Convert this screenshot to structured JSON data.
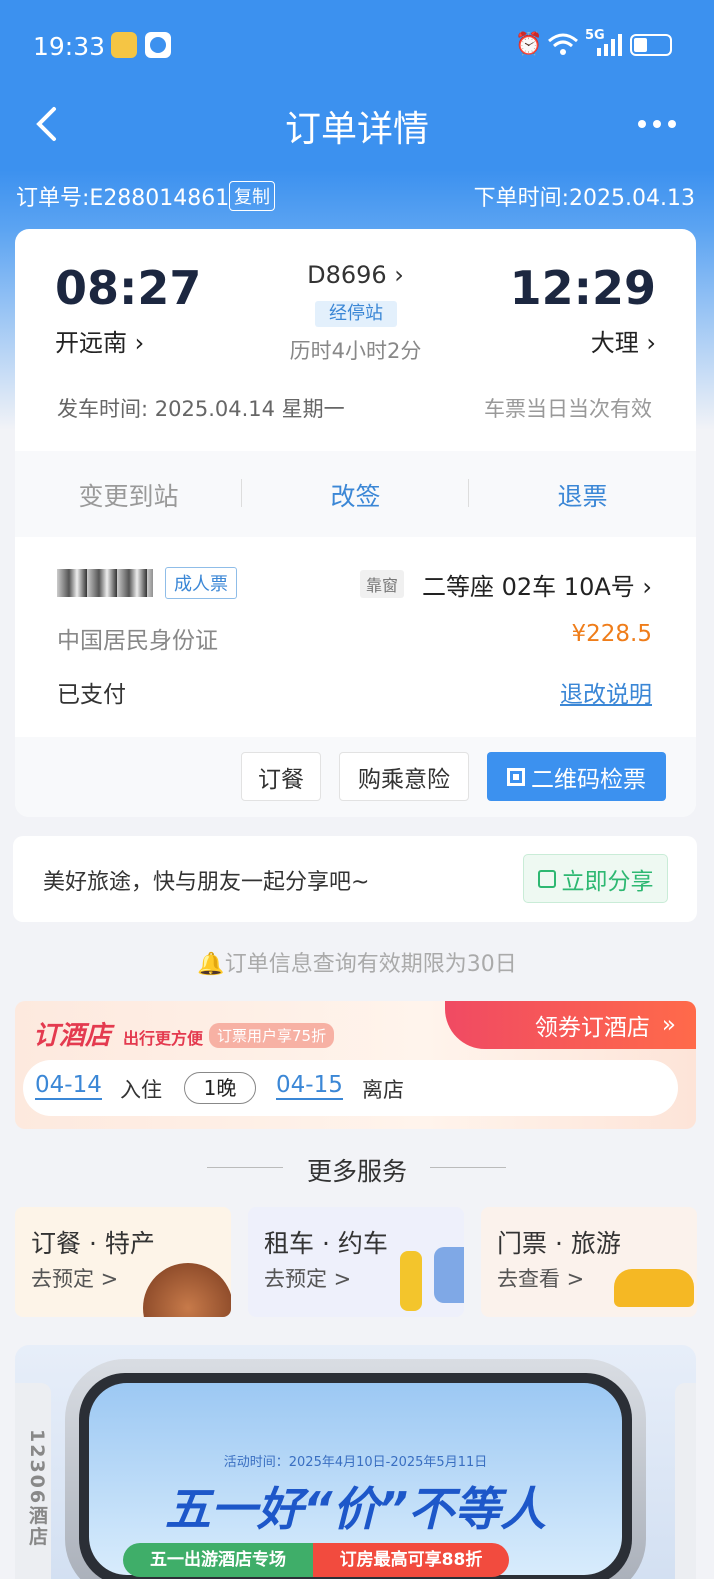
{
  "status_bar": {
    "time": "19:33",
    "network": "5G"
  },
  "nav": {
    "title": "订单详情"
  },
  "order": {
    "number_label": "订单号:E288014861",
    "copy_label": "复制",
    "time_label": "下单时间:2025.04.13"
  },
  "trip": {
    "dep_time": "08:27",
    "dep_station": "开远南",
    "train_no": "D8696",
    "stops_label": "经停站",
    "duration": "历时4小时2分",
    "arr_time": "12:29",
    "arr_station": "大理",
    "departure_label": "发车时间: 2025.04.14 星期一",
    "validity": "车票当日当次有效"
  },
  "actions": {
    "change_station": "变更到站",
    "rebook": "改签",
    "refund": "退票"
  },
  "passenger": {
    "ticket_type": "成人票",
    "window_tag": "靠窗",
    "seat": "二等座 02车 10A号",
    "id_type": "中国居民身份证",
    "price": "¥228.5",
    "pay_status": "已支付",
    "rules_link": "退改说明"
  },
  "ticket_buttons": {
    "meal": "订餐",
    "insurance": "购乘意险",
    "qr": "二维码检票"
  },
  "share": {
    "text": "美好旅途，快与朋友一起分享吧~",
    "button": "立即分享"
  },
  "notice": "订单信息查询有效期限为30日",
  "hotel": {
    "title": "订酒店",
    "slogan": "出行更方便",
    "promo": "订票用户享75折",
    "coupon": "领券订酒店",
    "checkin_date": "04-14",
    "checkin_label": "入住",
    "nights": "1晚",
    "checkout_date": "04-15",
    "checkout_label": "离店"
  },
  "more": {
    "title": "更多服务",
    "items": [
      {
        "title": "订餐 · 特产",
        "sub": "去预定 >"
      },
      {
        "title": "租车 · 约车",
        "sub": "去预定 >"
      },
      {
        "title": "门票 · 旅游",
        "sub": "去查看 >"
      }
    ]
  },
  "banner": {
    "side_text": "12306酒店",
    "period": "活动时间：2025年4月10日-2025年5月11日",
    "headline": "五一好“价”不等人",
    "pill_left": "五一出游酒店专场",
    "pill_right": "订房最高可享88折"
  },
  "colors": {
    "primary": "#3c91ef",
    "accent_blue": "#3b87d6",
    "price": "#ef7d1a",
    "share_green": "#2eb872",
    "hotel_red": "#e43a4f"
  }
}
